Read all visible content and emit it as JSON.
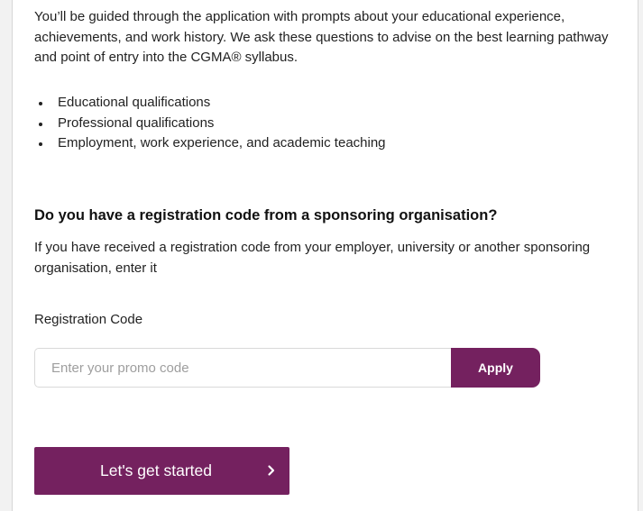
{
  "intro": {
    "text": "You’ll be guided through the application with prompts about your educational experience, achievements, and work history. We ask these questions to advise on the best learning pathway and point of entry into the CGMA® syllabus."
  },
  "qualifications": [
    "Educational qualifications",
    "Professional qualifications",
    "Employment, work experience, and academic teaching"
  ],
  "registration": {
    "heading": "Do you have a registration code from a sponsoring organisation?",
    "description": "If you have received a registration code from your employer, university or another sponsoring organisation, enter it",
    "field_label": "Registration Code",
    "input_value": "",
    "input_placeholder": "Enter your promo code",
    "apply_label": "Apply"
  },
  "cta": {
    "start_label": "Let's get started",
    "icon": "chevron-right-icon"
  },
  "colors": {
    "brand": "#74215f",
    "text": "#222222",
    "placeholder": "#9e9e9e",
    "border": "#d9d9d9"
  }
}
